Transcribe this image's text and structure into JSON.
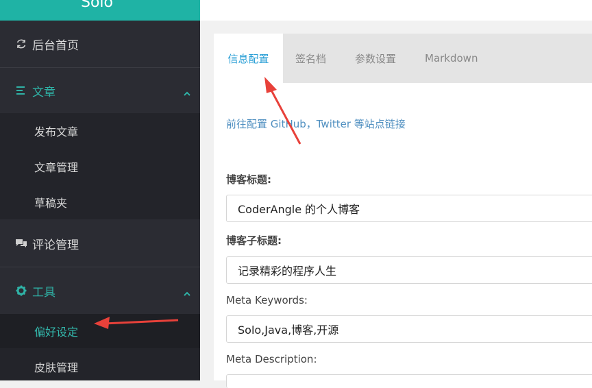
{
  "sidebar": {
    "logo": "Solo",
    "items": [
      {
        "label": "后台首页"
      },
      {
        "label": "文章"
      },
      {
        "label": "评论管理"
      },
      {
        "label": "工具"
      }
    ],
    "article_sub": [
      {
        "label": "发布文章"
      },
      {
        "label": "文章管理"
      },
      {
        "label": "草稿夹"
      }
    ],
    "tools_sub": [
      {
        "label": "偏好设定"
      },
      {
        "label": "皮肤管理"
      }
    ]
  },
  "tabs": [
    {
      "label": "信息配置"
    },
    {
      "label": "签名档"
    },
    {
      "label": "参数设置"
    },
    {
      "label": "Markdown"
    }
  ],
  "form": {
    "link_text": "前往配置 GitHub，Twitter 等站点链接",
    "blog_title_label": "博客标题:",
    "blog_title_value": "CoderAngle 的个人博客",
    "blog_subtitle_label": "博客子标题:",
    "blog_subtitle_value": "记录精彩的程序人生",
    "meta_keywords_label": "Meta Keywords:",
    "meta_keywords_value": "Solo,Java,博客,开源",
    "meta_description_label": "Meta Description:"
  },
  "colors": {
    "accent": "#1fb3a5",
    "sidebar_bg": "#2b2c33",
    "tab_active": "#2a9fd6",
    "annotation_arrow": "#e8413a"
  },
  "icons": {
    "home": "refresh-icon",
    "article": "list-icon",
    "comments": "comments-icon",
    "tools": "gear-icon"
  }
}
